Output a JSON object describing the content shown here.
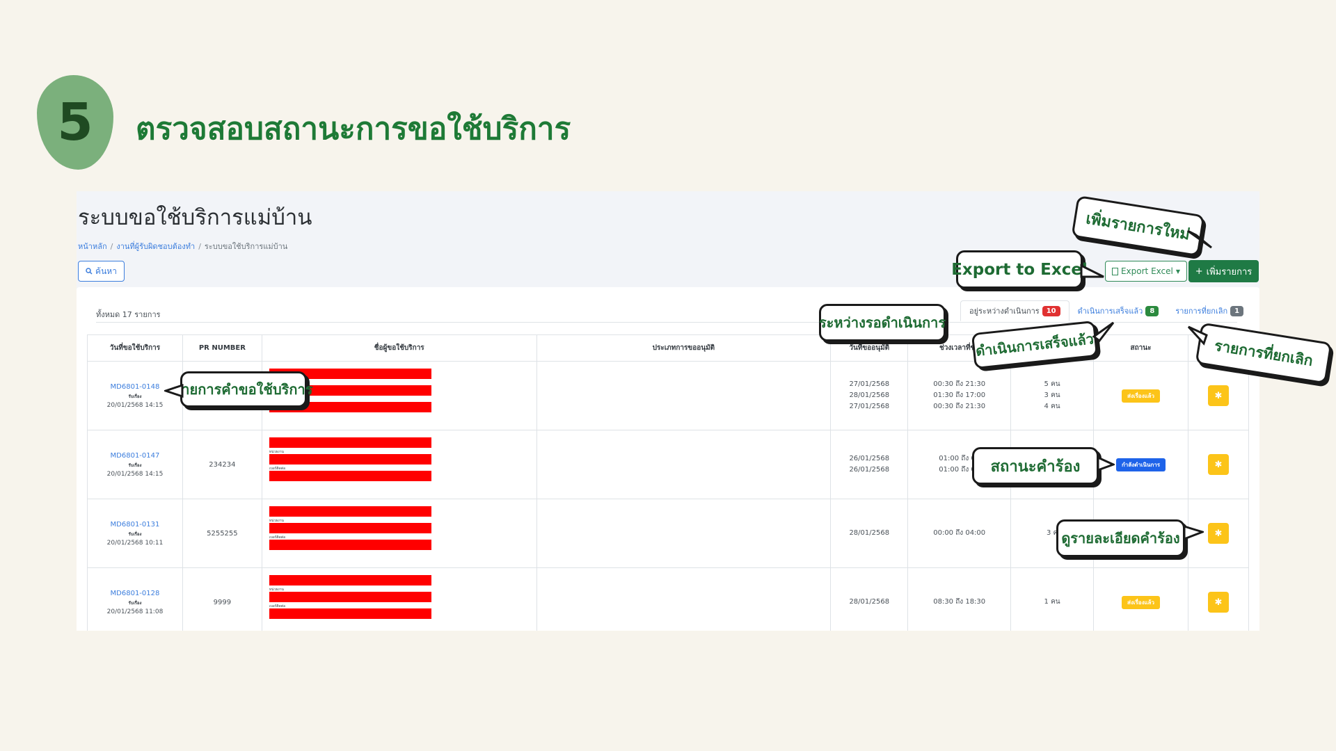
{
  "step": {
    "number": "5",
    "title": "ตรวจสอบสถานะการขอใช้บริการ"
  },
  "page": {
    "title": "ระบบขอใช้บริการแม่บ้าน",
    "breadcrumb": [
      "หน้าหลัก",
      "งานที่ผู้รับผิดชอบต้องทำ",
      "ระบบขอใช้บริการแม่บ้าน"
    ],
    "search_label": "ค้นหา",
    "export_label": "Export Excel",
    "add_label": "เพิ่มรายการ",
    "total_text": "ทั้งหมด 17 รายการ"
  },
  "tabs": [
    {
      "label": "อยู่ระหว่างดำเนินการ",
      "count": "10",
      "color": "#e03131"
    },
    {
      "label": "ดำเนินการเสร็จแล้ว",
      "count": "8",
      "color": "#2b8a3e"
    },
    {
      "label": "รายการที่ยกเลิก",
      "count": "1",
      "color": "#6c757d"
    }
  ],
  "table": {
    "headers": [
      "วันที่ขอใช้บริการ",
      "PR NUMBER",
      "ชื่อผู้ขอใช้บริการ",
      "ประเภทการขออนุมัติ",
      "วันที่ขออนุมัติ",
      "ช่วงเวลาที่ขอ",
      "",
      "สถานะ",
      ""
    ],
    "rows": [
      {
        "id": "MD6801-0148",
        "sub": "รับเรื่อง",
        "datetime": "20/01/2568 14:15",
        "pr": "",
        "dates": [
          "27/01/2568",
          "28/01/2568",
          "27/01/2568"
        ],
        "times": [
          "00:30 ถึง 21:30",
          "01:30 ถึง 17:00",
          "00:30 ถึง 21:30"
        ],
        "people": [
          "5 คน",
          "3 คน",
          "4 คน"
        ],
        "status": "ส่งเรื่องแล้ว",
        "status_type": "yellow",
        "labels": []
      },
      {
        "id": "MD6801-0147",
        "sub": "รับเรื่อง",
        "datetime": "20/01/2568 14:15",
        "pr": "234234",
        "dates": [
          "26/01/2568",
          "26/01/2568"
        ],
        "times": [
          "01:00 ถึง 02",
          "01:00 ถึง 02"
        ],
        "people": [],
        "status": "กำลังดำเนินการ",
        "status_type": "blue",
        "labels": [
          "หน่วยงาน",
          "เบอร์ติดต่อ"
        ]
      },
      {
        "id": "MD6801-0131",
        "sub": "รับเรื่อง",
        "datetime": "20/01/2568 10:11",
        "pr": "5255255",
        "dates": [
          "28/01/2568"
        ],
        "times": [
          "00:00 ถึง 04:00"
        ],
        "people": [
          "3 ค"
        ],
        "status": "",
        "status_type": "none",
        "labels": [
          "หน่วยงาน",
          "เบอร์ติดต่อ"
        ]
      },
      {
        "id": "MD6801-0128",
        "sub": "รับเรื่อง",
        "datetime": "20/01/2568 11:08",
        "pr": "9999",
        "dates": [
          "28/01/2568"
        ],
        "times": [
          "08:30 ถึง 18:30"
        ],
        "people": [
          "1 คน"
        ],
        "status": "ส่งเรื่องแล้ว",
        "status_type": "yellow",
        "labels": [
          "หน่วยงาน",
          "เบอร์ติดต่อ"
        ]
      }
    ]
  },
  "callouts": {
    "add_new": "เพิ่มรายการใหม่",
    "export": "Export to Excel",
    "pending": "ระหว่างรอดำเนินการ",
    "done": "ดำเนินการเสร็จแล้ว",
    "cancelled": "รายการที่ยกเลิก",
    "request_list": "รายการคำขอใช้บริการ",
    "request_status": "สถานะคำร้อง",
    "view_detail": "ดูรายละเอียดคำร้อง"
  },
  "colors": {
    "accent": "#1e7a36",
    "brand_green": "#1f7a45",
    "link": "#3b7ddd",
    "redaction": "#ff0000",
    "warning": "#fcc419"
  }
}
